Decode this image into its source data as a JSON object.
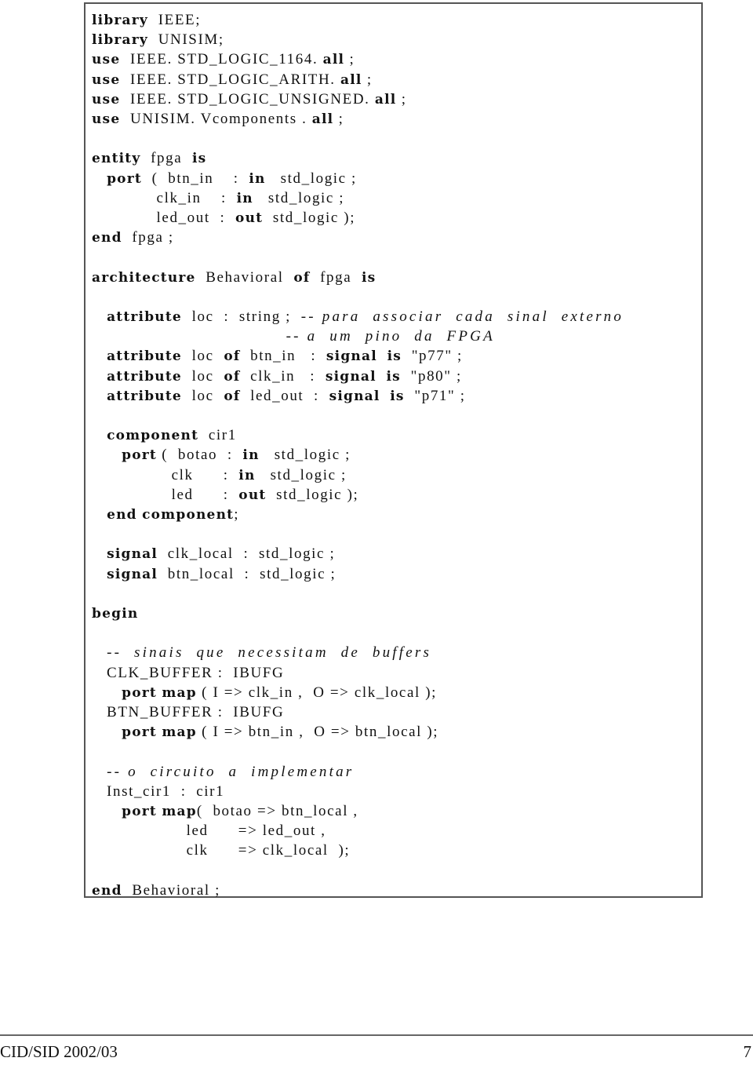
{
  "code_listing": {
    "language": "VHDL",
    "lines": [
      {
        "tokens": [
          {
            "t": "library",
            "s": "kw"
          },
          {
            "t": "  IEEE;",
            "s": "n"
          }
        ]
      },
      {
        "tokens": [
          {
            "t": "library",
            "s": "kw"
          },
          {
            "t": "  UNISIM;",
            "s": "n"
          }
        ]
      },
      {
        "tokens": [
          {
            "t": "use",
            "s": "kw"
          },
          {
            "t": "  IEEE. STD_LOGIC_1164. ",
            "s": "n"
          },
          {
            "t": "all",
            "s": "kw"
          },
          {
            "t": " ;",
            "s": "n"
          }
        ]
      },
      {
        "tokens": [
          {
            "t": "use",
            "s": "kw"
          },
          {
            "t": "  IEEE. STD_LOGIC_ARITH. ",
            "s": "n"
          },
          {
            "t": "all",
            "s": "kw"
          },
          {
            "t": " ;",
            "s": "n"
          }
        ]
      },
      {
        "tokens": [
          {
            "t": "use",
            "s": "kw"
          },
          {
            "t": "  IEEE. STD_LOGIC_UNSIGNED. ",
            "s": "n"
          },
          {
            "t": "all",
            "s": "kw"
          },
          {
            "t": " ;",
            "s": "n"
          }
        ]
      },
      {
        "tokens": [
          {
            "t": "use",
            "s": "kw"
          },
          {
            "t": "  UNISIM. Vcomponents . ",
            "s": "n"
          },
          {
            "t": "all",
            "s": "kw"
          },
          {
            "t": " ;",
            "s": "n"
          }
        ]
      },
      {
        "tokens": []
      },
      {
        "tokens": [
          {
            "t": "entity",
            "s": "kw"
          },
          {
            "t": "  fpga  ",
            "s": "n"
          },
          {
            "t": "is",
            "s": "kw"
          }
        ]
      },
      {
        "tokens": [
          {
            "t": "   ",
            "s": "n"
          },
          {
            "t": "port",
            "s": "kw"
          },
          {
            "t": "  (  btn_in    :  ",
            "s": "n"
          },
          {
            "t": "in",
            "s": "kw"
          },
          {
            "t": "   std_logic ;",
            "s": "n"
          }
        ]
      },
      {
        "tokens": [
          {
            "t": "             clk_in    :  ",
            "s": "n"
          },
          {
            "t": "in",
            "s": "kw"
          },
          {
            "t": "   std_logic ;",
            "s": "n"
          }
        ]
      },
      {
        "tokens": [
          {
            "t": "             led_out  :  ",
            "s": "n"
          },
          {
            "t": "out",
            "s": "kw"
          },
          {
            "t": "  std_logic );",
            "s": "n"
          }
        ]
      },
      {
        "tokens": [
          {
            "t": "end",
            "s": "kw"
          },
          {
            "t": "  fpga ;",
            "s": "n"
          }
        ]
      },
      {
        "tokens": []
      },
      {
        "tokens": [
          {
            "t": "architecture",
            "s": "kw"
          },
          {
            "t": "  Behavioral  ",
            "s": "n"
          },
          {
            "t": "of",
            "s": "kw"
          },
          {
            "t": "  fpga  ",
            "s": "n"
          },
          {
            "t": "is",
            "s": "kw"
          }
        ]
      },
      {
        "tokens": []
      },
      {
        "tokens": [
          {
            "t": "   ",
            "s": "n"
          },
          {
            "t": "attribute",
            "s": "kw"
          },
          {
            "t": "  loc  :  string ;  ",
            "s": "n"
          },
          {
            "t": "-- para  associar  cada  sinal  externo",
            "s": "cm"
          }
        ]
      },
      {
        "tokens": [
          {
            "t": "                                       ",
            "s": "n"
          },
          {
            "t": "-- a  um  pino  da  FPGA",
            "s": "cm"
          }
        ]
      },
      {
        "tokens": [
          {
            "t": "   ",
            "s": "n"
          },
          {
            "t": "attribute",
            "s": "kw"
          },
          {
            "t": "  loc  ",
            "s": "n"
          },
          {
            "t": "of",
            "s": "kw"
          },
          {
            "t": "  btn_in   :  ",
            "s": "n"
          },
          {
            "t": "signal",
            "s": "kw"
          },
          {
            "t": "  ",
            "s": "n"
          },
          {
            "t": "is",
            "s": "kw"
          },
          {
            "t": "  \"p77\" ;",
            "s": "n"
          }
        ]
      },
      {
        "tokens": [
          {
            "t": "   ",
            "s": "n"
          },
          {
            "t": "attribute",
            "s": "kw"
          },
          {
            "t": "  loc  ",
            "s": "n"
          },
          {
            "t": "of",
            "s": "kw"
          },
          {
            "t": "  clk_in   :  ",
            "s": "n"
          },
          {
            "t": "signal",
            "s": "kw"
          },
          {
            "t": "  ",
            "s": "n"
          },
          {
            "t": "is",
            "s": "kw"
          },
          {
            "t": "  \"p80\" ;",
            "s": "n"
          }
        ]
      },
      {
        "tokens": [
          {
            "t": "   ",
            "s": "n"
          },
          {
            "t": "attribute",
            "s": "kw"
          },
          {
            "t": "  loc  ",
            "s": "n"
          },
          {
            "t": "of",
            "s": "kw"
          },
          {
            "t": "  led_out  :  ",
            "s": "n"
          },
          {
            "t": "signal",
            "s": "kw"
          },
          {
            "t": "  ",
            "s": "n"
          },
          {
            "t": "is",
            "s": "kw"
          },
          {
            "t": "  \"p71\" ;",
            "s": "n"
          }
        ]
      },
      {
        "tokens": []
      },
      {
        "tokens": [
          {
            "t": "   ",
            "s": "n"
          },
          {
            "t": "component",
            "s": "kw"
          },
          {
            "t": "  cir1",
            "s": "n"
          }
        ]
      },
      {
        "tokens": [
          {
            "t": "      ",
            "s": "n"
          },
          {
            "t": "port",
            "s": "kw"
          },
          {
            "t": " (  botao  :  ",
            "s": "n"
          },
          {
            "t": "in",
            "s": "kw"
          },
          {
            "t": "   std_logic ;",
            "s": "n"
          }
        ]
      },
      {
        "tokens": [
          {
            "t": "                clk      :  ",
            "s": "n"
          },
          {
            "t": "in",
            "s": "kw"
          },
          {
            "t": "   std_logic ;",
            "s": "n"
          }
        ]
      },
      {
        "tokens": [
          {
            "t": "                led      :  ",
            "s": "n"
          },
          {
            "t": "out",
            "s": "kw"
          },
          {
            "t": "  std_logic );",
            "s": "n"
          }
        ]
      },
      {
        "tokens": [
          {
            "t": "   ",
            "s": "n"
          },
          {
            "t": "end",
            "s": "kw"
          },
          {
            "t": " ",
            "s": "n"
          },
          {
            "t": "component",
            "s": "kw"
          },
          {
            "t": ";",
            "s": "n"
          }
        ]
      },
      {
        "tokens": []
      },
      {
        "tokens": [
          {
            "t": "   ",
            "s": "n"
          },
          {
            "t": "signal",
            "s": "kw"
          },
          {
            "t": "  clk_local  :  std_logic ;",
            "s": "n"
          }
        ]
      },
      {
        "tokens": [
          {
            "t": "   ",
            "s": "n"
          },
          {
            "t": "signal",
            "s": "kw"
          },
          {
            "t": "  btn_local  :  std_logic ;",
            "s": "n"
          }
        ]
      },
      {
        "tokens": []
      },
      {
        "tokens": [
          {
            "t": "begin",
            "s": "kw"
          }
        ]
      },
      {
        "tokens": []
      },
      {
        "tokens": [
          {
            "t": "   ",
            "s": "n"
          },
          {
            "t": "--  sinais  que  necessitam  de  buffers",
            "s": "cm"
          }
        ]
      },
      {
        "tokens": [
          {
            "t": "   CLK_BUFFER :  IBUFG",
            "s": "n"
          }
        ]
      },
      {
        "tokens": [
          {
            "t": "      ",
            "s": "n"
          },
          {
            "t": "port",
            "s": "kw"
          },
          {
            "t": " ",
            "s": "n"
          },
          {
            "t": "map",
            "s": "kw"
          },
          {
            "t": " ( I => clk_in ,  O => clk_local );",
            "s": "n"
          }
        ]
      },
      {
        "tokens": [
          {
            "t": "   BTN_BUFFER :  IBUFG",
            "s": "n"
          }
        ]
      },
      {
        "tokens": [
          {
            "t": "      ",
            "s": "n"
          },
          {
            "t": "port",
            "s": "kw"
          },
          {
            "t": " ",
            "s": "n"
          },
          {
            "t": "map",
            "s": "kw"
          },
          {
            "t": " ( I => btn_in ,  O => btn_local );",
            "s": "n"
          }
        ]
      },
      {
        "tokens": []
      },
      {
        "tokens": [
          {
            "t": "   ",
            "s": "n"
          },
          {
            "t": "-- o  circuito  a  implementar",
            "s": "cm"
          }
        ]
      },
      {
        "tokens": [
          {
            "t": "   Inst_cir1  :  cir1",
            "s": "n"
          }
        ]
      },
      {
        "tokens": [
          {
            "t": "      ",
            "s": "n"
          },
          {
            "t": "port",
            "s": "kw"
          },
          {
            "t": " ",
            "s": "n"
          },
          {
            "t": "map",
            "s": "kw"
          },
          {
            "t": "(  botao => btn_local ,",
            "s": "n"
          }
        ]
      },
      {
        "tokens": [
          {
            "t": "                   led      => led_out ,",
            "s": "n"
          }
        ]
      },
      {
        "tokens": [
          {
            "t": "                   clk      => clk_local  );",
            "s": "n"
          }
        ]
      },
      {
        "tokens": []
      },
      {
        "tokens": [
          {
            "t": "end",
            "s": "kw"
          },
          {
            "t": "  Behavioral ;",
            "s": "n"
          }
        ]
      }
    ]
  },
  "footer": {
    "left": "CID/SID 2002/03",
    "page_number": "7"
  }
}
